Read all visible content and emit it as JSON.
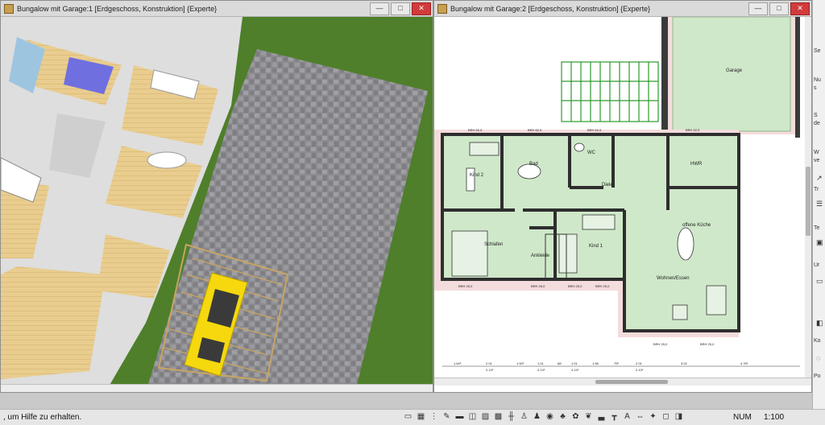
{
  "left_window": {
    "title": "Bungalow mit Garage:1 [Erdgeschoss, Konstruktion] {Experte}",
    "buttons": {
      "minimize": "—",
      "maximize": "□",
      "close": "✕"
    }
  },
  "right_window": {
    "title": "Bungalow mit Garage:2 [Erdgeschoss, Konstruktion] {Experte}",
    "buttons": {
      "minimize": "—",
      "maximize": "□",
      "close": "✕"
    }
  },
  "plan": {
    "rooms": [
      "Garage",
      "Kind 2",
      "Bad",
      "WC",
      "HWR",
      "Diele",
      "Schlafen",
      "Ankleide",
      "Kind 1",
      "offene Küche",
      "Wohnen/Essen"
    ],
    "brh_labels": [
      "BRH 62,5",
      "BRH 62,5",
      "BRH 62,5",
      "BRH 62,5",
      "BRH 25,0",
      "BRH 25,0",
      "BRH 25,0",
      "BRH 25,0",
      "BRH 25,0",
      "BRH 25,0"
    ],
    "dimensions": [
      "1.64⁵",
      "2.01",
      "2.13⁵",
      "1.50⁵",
      "1.01",
      "2.13⁵",
      ".88",
      "1.01",
      "2.13⁵",
      "1.58",
      ".75⁵",
      "2.01",
      "2.13⁵",
      "3.02",
      "4.76⁵"
    ]
  },
  "right_panel_items": [
    "Se",
    "Nu",
    "s",
    "S",
    "de",
    "W",
    "ve",
    "Tr",
    "Te",
    "Ur",
    "Ko",
    "Po"
  ],
  "status": {
    "help_text": ", um Hilfe zu erhalten.",
    "num": "NUM",
    "scale": "1:100"
  },
  "colors": {
    "grass": "#4f7f2a",
    "paving": "#8a8a8e",
    "floor_wood": "#e8cc8e",
    "plan_room": "#cfe8c9",
    "plan_terrace": "#f4dcdc",
    "wall": "#3a3a3a",
    "car": "#f5d80e",
    "pergola": "#2d9a2d"
  }
}
